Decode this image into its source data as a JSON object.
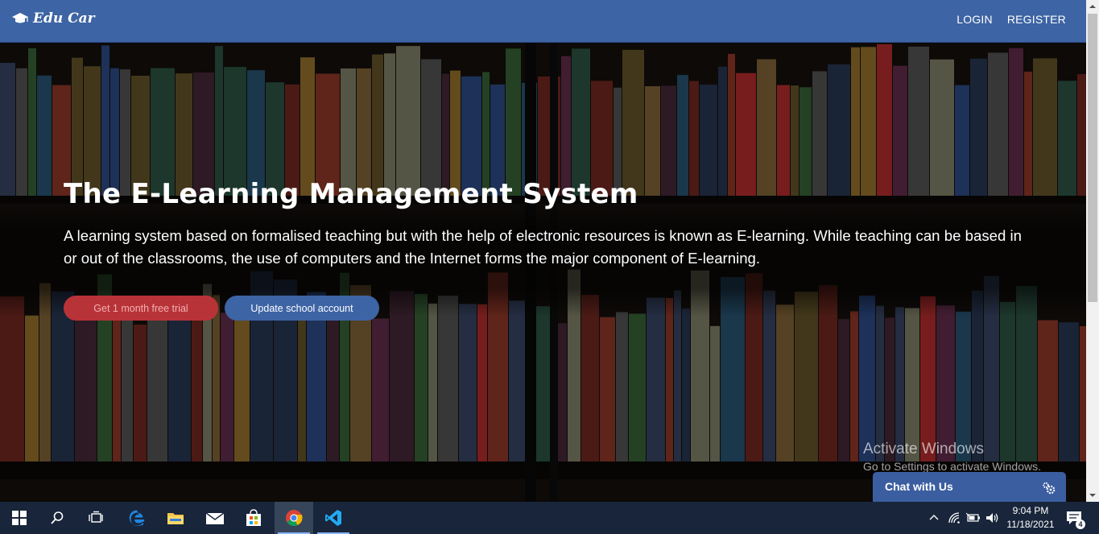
{
  "navbar": {
    "brand": "Edu Car",
    "links": [
      "LOGIN",
      "REGISTER"
    ]
  },
  "hero": {
    "title": "The E-Learning Management System",
    "description": "A learning system based on formalised teaching but with the help of electronic resources is known as E-learning. While teaching can be based in or out of the classrooms, the use of computers and the Internet forms the major component of E-learning.",
    "buttons": {
      "trial": "Get 1 month free trial",
      "update": "Update school account"
    }
  },
  "watermark": {
    "line1": "Activate Windows",
    "line2": "Go to Settings to activate Windows."
  },
  "chat": {
    "label": "Chat with Us",
    "icon": "gears-icon"
  },
  "taskbar": {
    "apps": [
      "windows-start-icon",
      "search-icon",
      "task-view-icon",
      "edge-icon",
      "file-explorer-icon",
      "mail-icon",
      "store-icon",
      "chrome-icon",
      "vscode-icon"
    ],
    "active_app": "chrome-icon",
    "time": "9:04 PM",
    "date": "11/18/2021",
    "notification_count": "4"
  },
  "colors": {
    "navbar": "#3d64a4",
    "trial_button": "#b83338",
    "update_button": "#3d64a4",
    "taskbar": "#18253a"
  }
}
